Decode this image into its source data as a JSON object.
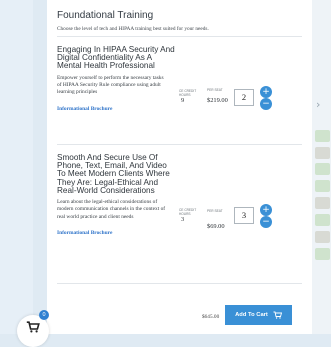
{
  "section": {
    "title": "Foundational Training",
    "subtitle": "Choose the level of tech and HIPAA training best suited for your needs."
  },
  "courses": [
    {
      "title": "Engaging In HIPAA Security And Digital Confidentiality As A Mental Health Professional",
      "description": "Empower yourself to perform the necessary tasks of HIPAA Security Rule compliance using adult learning principles",
      "link": "Informational Brochure",
      "credit_label": "CE CREDIT HOURS",
      "credit_value": "9",
      "price_label": "PER SEAT",
      "price": "$219.00",
      "quantity": "2"
    },
    {
      "title": "Smooth And Secure Use Of Phone, Text, Email, And Video To Meet Modern Clients Where They Are: Legal-Ethical And Real-World Considerations",
      "description": "Learn about the legal-ethical considerations of modern communication channels in the context of real world practice and client needs",
      "link": "Informational Brochure",
      "credit_label": "CE CREDIT HOURS",
      "credit_value": "3",
      "price_label": "PER SEAT",
      "price": "$69.00",
      "quantity": "3"
    }
  ],
  "cart": {
    "total": "$645.00",
    "button_label": "Add To Cart",
    "badge_count": "0"
  },
  "colors": {
    "accent": "#3a90d6",
    "link": "#2e73c9"
  },
  "icons": {
    "plus": "plus-icon",
    "minus": "minus-icon",
    "cart": "cart-icon"
  }
}
